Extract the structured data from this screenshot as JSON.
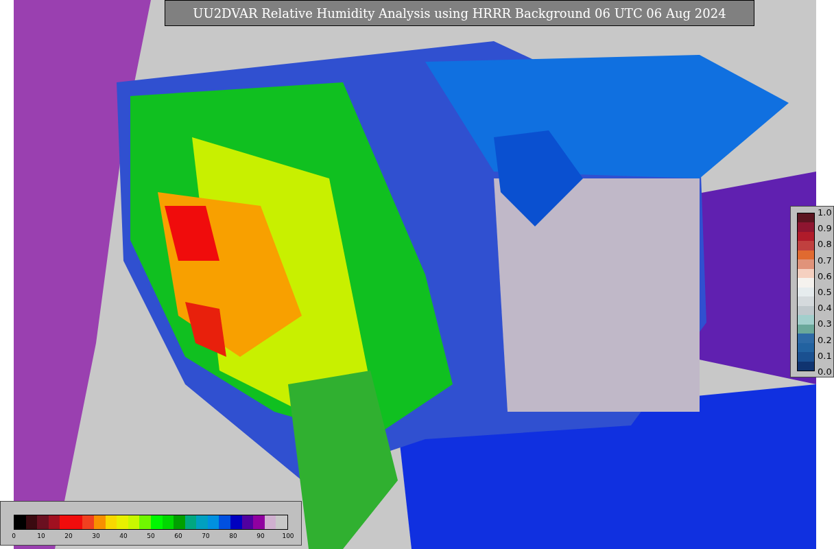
{
  "title": "UU2DVAR Relative Humidity Analysis using HRRR Background 06 UTC 06 Aug 2024",
  "humidity_legend": {
    "segments": [
      {
        "color": "#000000"
      },
      {
        "color": "#3a0a10"
      },
      {
        "color": "#6a1020"
      },
      {
        "color": "#a01020"
      },
      {
        "color": "#f00c0c"
      },
      {
        "color": "#f00c0c"
      },
      {
        "color": "#f04020"
      },
      {
        "color": "#f89000"
      },
      {
        "color": "#f8d800"
      },
      {
        "color": "#e8f000"
      },
      {
        "color": "#c8f800"
      },
      {
        "color": "#70f800"
      },
      {
        "color": "#00f800"
      },
      {
        "color": "#00d800"
      },
      {
        "color": "#00a000"
      },
      {
        "color": "#00a880"
      },
      {
        "color": "#00a0c0"
      },
      {
        "color": "#0090e0"
      },
      {
        "color": "#0050e0"
      },
      {
        "color": "#0000c0"
      },
      {
        "color": "#5000a0"
      },
      {
        "color": "#9000a0"
      },
      {
        "color": "#d0b0d0"
      },
      {
        "color": "#c8c8c8"
      }
    ],
    "ticks": [
      "0",
      "10",
      "20",
      "30",
      "40",
      "50",
      "60",
      "70",
      "80",
      "90",
      "100"
    ]
  },
  "ratio_legend": {
    "segments": [
      {
        "color": "#5c1420"
      },
      {
        "color": "#8e1530"
      },
      {
        "color": "#b01b2a"
      },
      {
        "color": "#c0403f"
      },
      {
        "color": "#e06a30"
      },
      {
        "color": "#e0937a"
      },
      {
        "color": "#f5d0c0"
      },
      {
        "color": "#f5f2ee"
      },
      {
        "color": "#e6ecee"
      },
      {
        "color": "#d5dadd"
      },
      {
        "color": "#c0c8cc"
      },
      {
        "color": "#a2cfcc"
      },
      {
        "color": "#6aa89a"
      },
      {
        "color": "#2e6aa6"
      },
      {
        "color": "#2262a0"
      },
      {
        "color": "#1a5090"
      },
      {
        "color": "#103470"
      }
    ],
    "ticks": [
      "1.0",
      "0.9",
      "0.8",
      "0.7",
      "0.6",
      "0.5",
      "0.4",
      "0.3",
      "0.2",
      "0.1",
      "0.0"
    ]
  }
}
